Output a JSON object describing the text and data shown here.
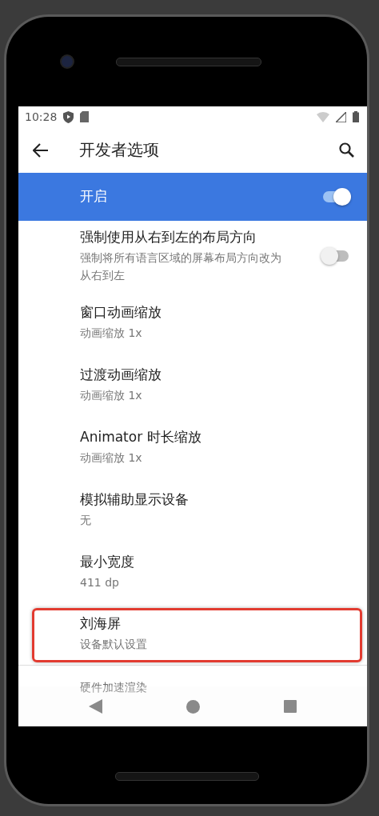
{
  "status_bar": {
    "time": "10:28"
  },
  "app_bar": {
    "title": "开发者选项"
  },
  "master_switch": {
    "label": "开启",
    "on": true
  },
  "settings": [
    {
      "kind": "switch",
      "title": "强制使用从右到左的布局方向",
      "summary": "强制将所有语言区域的屏幕布局方向改为从右到左",
      "on": false,
      "highlighted": false
    },
    {
      "kind": "value",
      "title": "窗口动画缩放",
      "summary": "动画缩放 1x",
      "highlighted": false
    },
    {
      "kind": "value",
      "title": "过渡动画缩放",
      "summary": "动画缩放 1x",
      "highlighted": false
    },
    {
      "kind": "value",
      "title": "Animator 时长缩放",
      "summary": "动画缩放 1x",
      "highlighted": false
    },
    {
      "kind": "value",
      "title": "模拟辅助显示设备",
      "summary": "无",
      "highlighted": false
    },
    {
      "kind": "value",
      "title": "最小宽度",
      "summary": "411 dp",
      "highlighted": false
    },
    {
      "kind": "value",
      "title": "刘海屏",
      "summary": "设备默认设置",
      "highlighted": true
    },
    {
      "kind": "peek",
      "title": "硬件加速渲染",
      "highlighted": false
    }
  ]
}
